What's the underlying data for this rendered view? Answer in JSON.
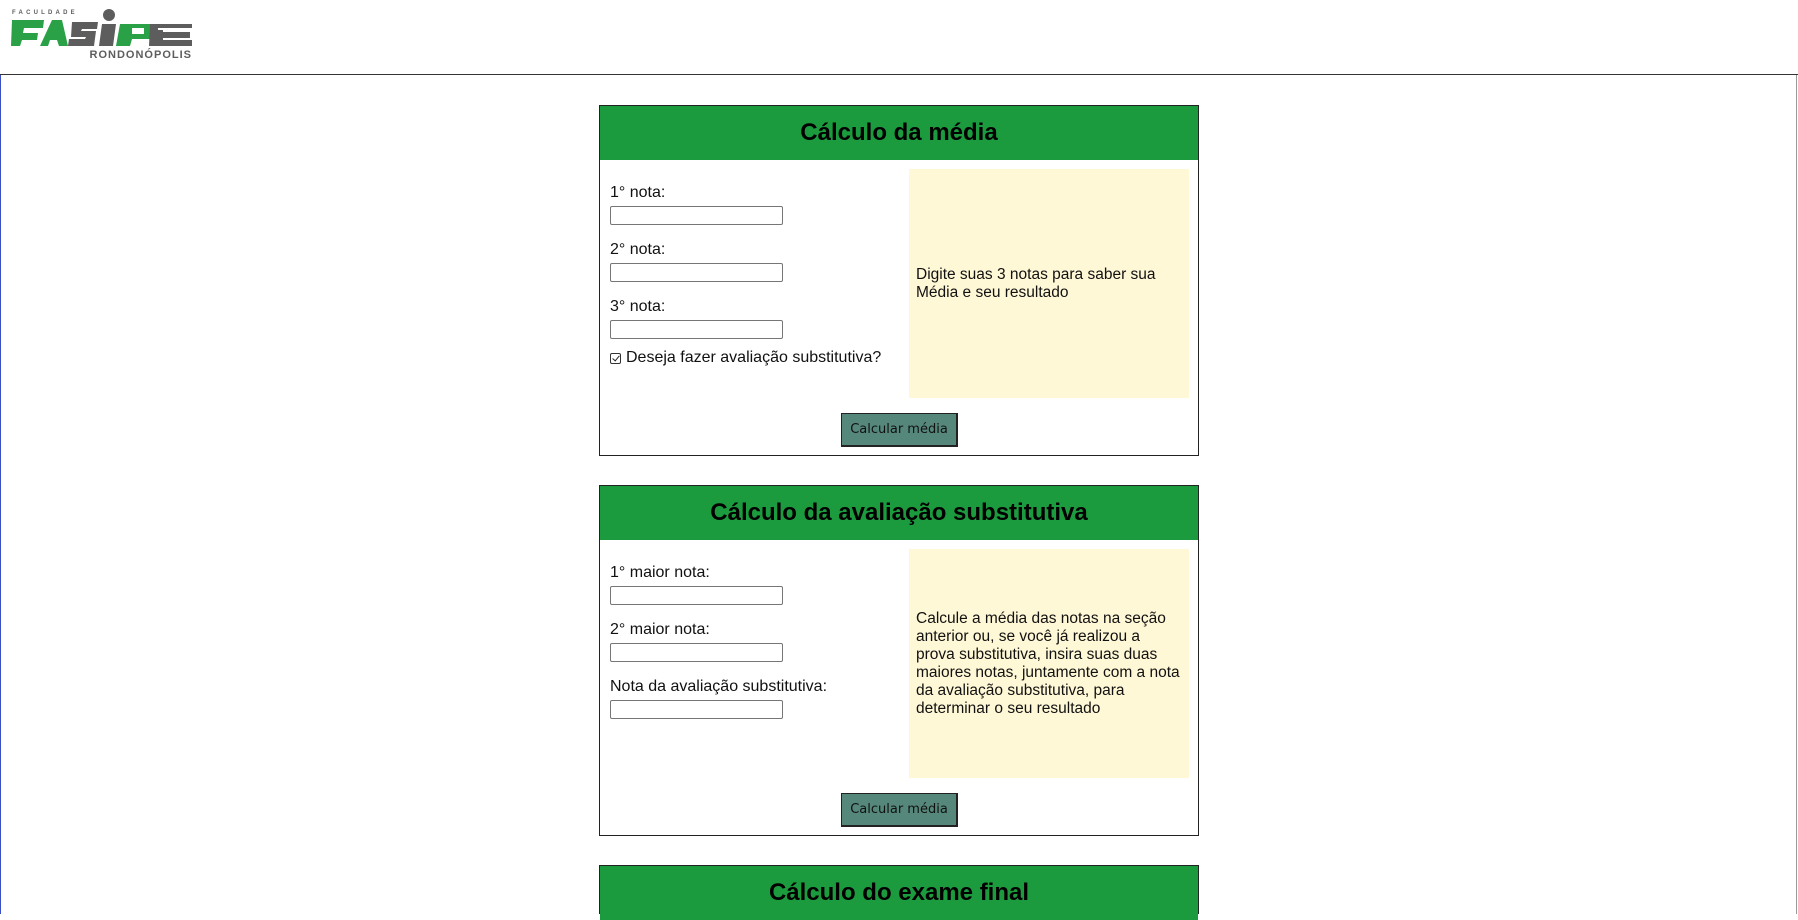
{
  "logo": {
    "top_text": "FACULDADE",
    "brand": "FASIPE",
    "city": "RONDONÓPOLIS"
  },
  "sections": [
    {
      "title": "Cálculo da média",
      "fields": [
        {
          "label": "1° nota:",
          "value": ""
        },
        {
          "label": "2° nota:",
          "value": ""
        },
        {
          "label": "3° nota:",
          "value": ""
        }
      ],
      "checkbox": {
        "label": "Deseja fazer avaliação substitutiva?",
        "checked": true
      },
      "info": "Digite suas 3 notas para saber sua Média e seu resultado",
      "button": "Calcular média"
    },
    {
      "title": "Cálculo da avaliação substitutiva",
      "fields": [
        {
          "label": "1° maior nota:",
          "value": ""
        },
        {
          "label": "2° maior nota:",
          "value": ""
        },
        {
          "label": "Nota da avaliação substitutiva:",
          "value": ""
        }
      ],
      "info": "Calcule a média das notas na seção anterior ou, se você já realizou a prova substitutiva, insira suas duas maiores notas, juntamente com a nota da avaliação substitutiva, para determinar o seu resultado",
      "button": "Calcular média"
    },
    {
      "title": "Cálculo do exame final"
    }
  ],
  "colors": {
    "header_green": "#1c9b3e",
    "logo_green": "#2aa147",
    "logo_gray": "#5d5d5d",
    "info_bg": "#fff8d6",
    "button_bg": "#55877a"
  }
}
